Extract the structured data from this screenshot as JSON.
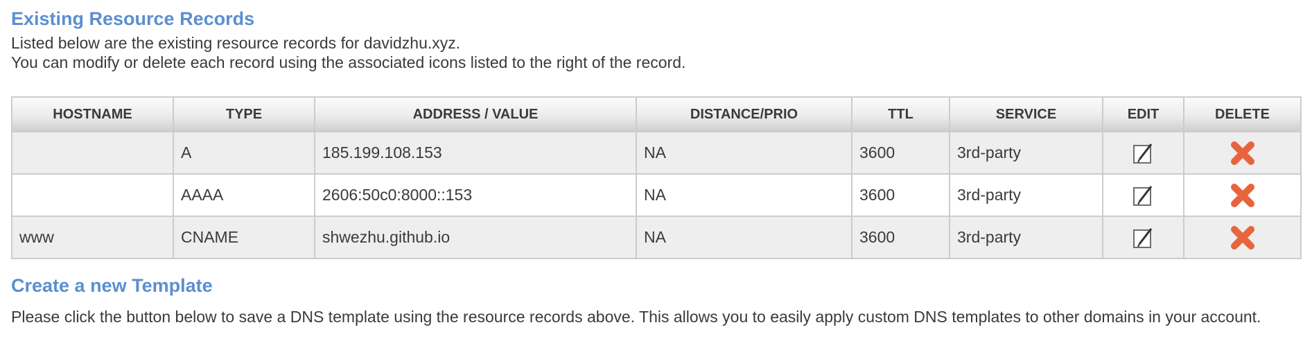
{
  "existing": {
    "title": "Existing Resource Records",
    "desc_line1": "Listed below are the existing resource records for davidzhu.xyz.",
    "desc_line2": "You can modify or delete each record using the associated icons listed to the right of the record."
  },
  "table": {
    "headers": {
      "hostname": "HOSTNAME",
      "type": "TYPE",
      "address": "ADDRESS / VALUE",
      "distance": "DISTANCE/PRIO",
      "ttl": "TTL",
      "service": "SERVICE",
      "edit": "EDIT",
      "delete": "DELETE"
    },
    "rows": [
      {
        "hostname": "",
        "type": "A",
        "address": "185.199.108.153",
        "distance": "NA",
        "ttl": "3600",
        "service": "3rd-party"
      },
      {
        "hostname": "",
        "type": "AAAA",
        "address": "2606:50c0:8000::153",
        "distance": "NA",
        "ttl": "3600",
        "service": "3rd-party"
      },
      {
        "hostname": "www",
        "type": "CNAME",
        "address": "shwezhu.github.io",
        "distance": "NA",
        "ttl": "3600",
        "service": "3rd-party"
      }
    ],
    "edit_icon": "edit-pencil-icon",
    "delete_icon": "delete-x-icon"
  },
  "template": {
    "title": "Create a new Template",
    "desc": "Please click the button below to save a DNS template using the resource records above. This allows you to easily apply custom DNS templates to other domains in your account."
  },
  "colors": {
    "heading": "#5b8fcf",
    "delete": "#e8643c",
    "row_alt": "#eeeeee",
    "border": "#cccccc"
  }
}
